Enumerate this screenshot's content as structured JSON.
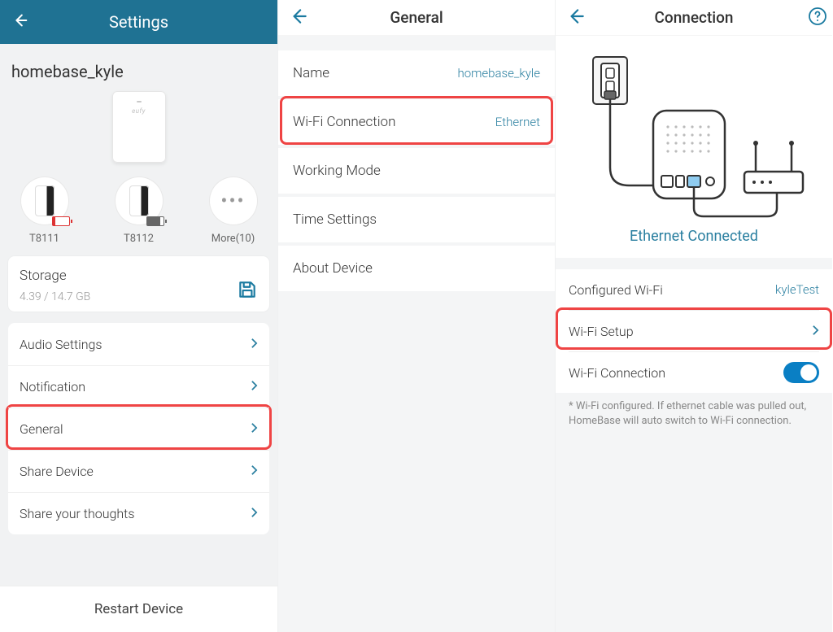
{
  "panel1": {
    "header_title": "Settings",
    "device_name": "homebase_kyle",
    "devices": [
      {
        "label": "T8111"
      },
      {
        "label": "T8112"
      }
    ],
    "more_label": "More(10)",
    "storage": {
      "title": "Storage",
      "value": "4.39 / 14.7 GB"
    },
    "rows": {
      "audio": "Audio Settings",
      "notification": "Notification",
      "general": "General",
      "share_device": "Share Device",
      "thoughts": "Share your thoughts"
    },
    "restart": "Restart Device"
  },
  "panel2": {
    "header_title": "General",
    "name_label": "Name",
    "name_value": "homebase_kyle",
    "wifi_label": "Wi-Fi Connection",
    "wifi_value": "Ethernet",
    "working_mode": "Working Mode",
    "time_settings": "Time Settings",
    "about": "About Device"
  },
  "panel3": {
    "header_title": "Connection",
    "eth_status": "Ethernet Connected",
    "configured_label": "Configured Wi-Fi",
    "configured_value": "kyleTest",
    "wifi_setup": "Wi-Fi Setup",
    "wifi_conn": "Wi-Fi Connection",
    "note": "* Wi-Fi configured. If ethernet cable was pulled out, HomeBase will auto switch to Wi-Fi connection."
  }
}
